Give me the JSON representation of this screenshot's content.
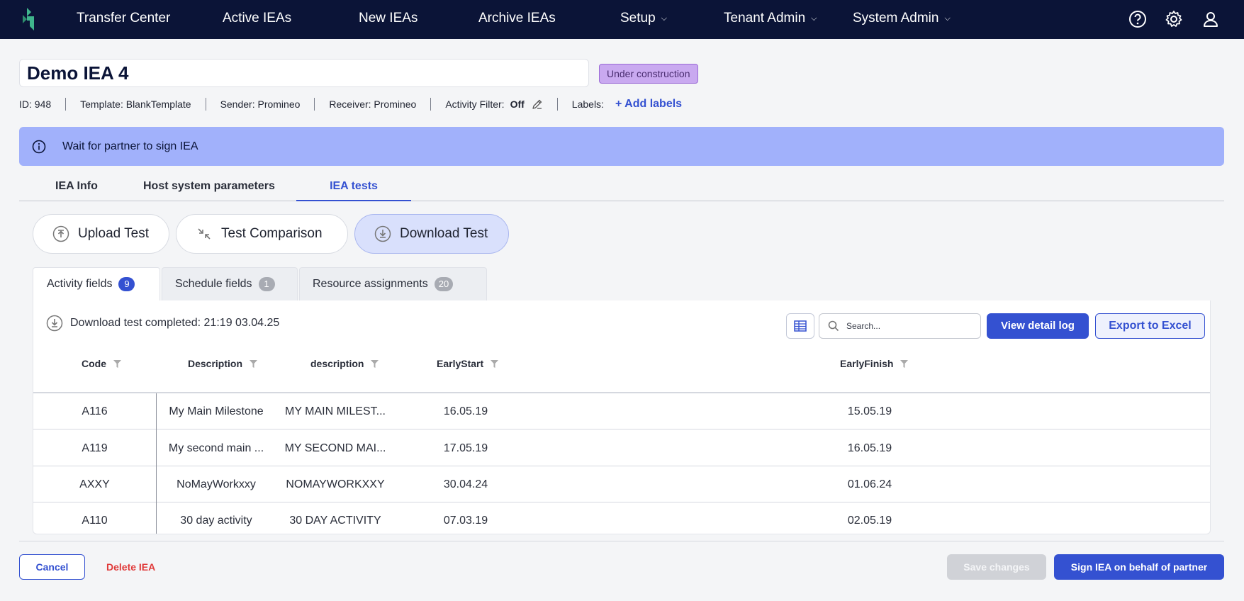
{
  "nav": {
    "items": [
      {
        "label": "Transfer Center"
      },
      {
        "label": "Active IEAs"
      },
      {
        "label": "New IEAs"
      },
      {
        "label": "Archive IEAs"
      },
      {
        "label": "Setup"
      },
      {
        "label": "Tenant Admin"
      },
      {
        "label": "System Admin"
      }
    ],
    "icons": [
      "help-icon",
      "gear-icon",
      "user-icon"
    ]
  },
  "iea": {
    "title": "Demo IEA 4",
    "status": "Under construction",
    "id_text": "ID: 948",
    "template_text": "Template: BlankTemplate",
    "sender_text": "Sender: Promineo",
    "receiver_text": "Receiver: Promineo",
    "activity_filter_label": "Activity Filter:",
    "activity_filter_value": "Off",
    "labels_label": "Labels:",
    "add_labels": "+ Add labels"
  },
  "banner": {
    "message": "Wait for partner to sign IEA",
    "icon": "info-icon"
  },
  "main_tabs": [
    {
      "label": "IEA Info"
    },
    {
      "label": "Host system parameters"
    },
    {
      "label": "IEA tests",
      "active": true
    }
  ],
  "actions": {
    "upload": "Upload Test",
    "compare": "Test Comparison",
    "download": "Download Test"
  },
  "sub_tabs": [
    {
      "label": "Activity fields",
      "count": "9",
      "active": true
    },
    {
      "label": "Schedule fields",
      "count": "1"
    },
    {
      "label": "Resource assignments",
      "count": "20"
    }
  ],
  "panel": {
    "download_status": "Download test completed: 21:19 03.04.25",
    "search_placeholder": "Search...",
    "view_log": "View detail log",
    "export": "Export to Excel"
  },
  "table": {
    "columns": [
      "Code",
      "Description",
      "description",
      "EarlyStart",
      "EarlyFinish"
    ],
    "rows": [
      [
        "A116",
        "My Main Milestone",
        "MY MAIN MILEST...",
        "16.05.19",
        "15.05.19"
      ],
      [
        "A119",
        "My second main ...",
        "MY SECOND MAI...",
        "17.05.19",
        "16.05.19"
      ],
      [
        "AXXY",
        "NoMayWorkxxy",
        "NOMAYWORKXXY",
        "30.04.24",
        "01.06.24"
      ],
      [
        "A110",
        "30 day activity",
        "30 DAY ACTIVITY",
        "07.03.19",
        "02.05.19"
      ]
    ]
  },
  "footer": {
    "cancel": "Cancel",
    "delete": "Delete IEA",
    "save": "Save changes",
    "sign": "Sign IEA on behalf of partner"
  },
  "colors": {
    "nav_bg": "#0b1437",
    "accent": "#3451d1",
    "banner_bg": "#a1b1fb",
    "status_badge_bg": "#c9a9f0",
    "danger": "#e03a3a"
  }
}
